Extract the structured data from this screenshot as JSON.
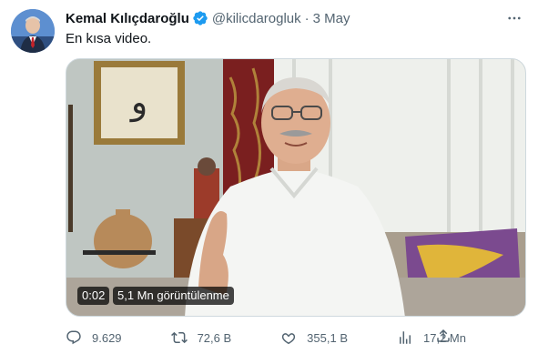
{
  "author": {
    "name": "Kemal Kılıçdaroğlu",
    "handle": "@kilicdarogluk",
    "separator": "·",
    "date": "3 May"
  },
  "tweet": {
    "text": "En kısa video."
  },
  "media": {
    "duration": "0:02",
    "views": "5,1 Mn görüntülenme"
  },
  "actions": {
    "replies": "9.629",
    "retweets": "72,6 B",
    "likes": "355,1 B",
    "views": "17,2 Mn"
  },
  "colors": {
    "verified": "#1d9bf0",
    "secondary_text": "#536471",
    "primary_text": "#0f1419"
  }
}
